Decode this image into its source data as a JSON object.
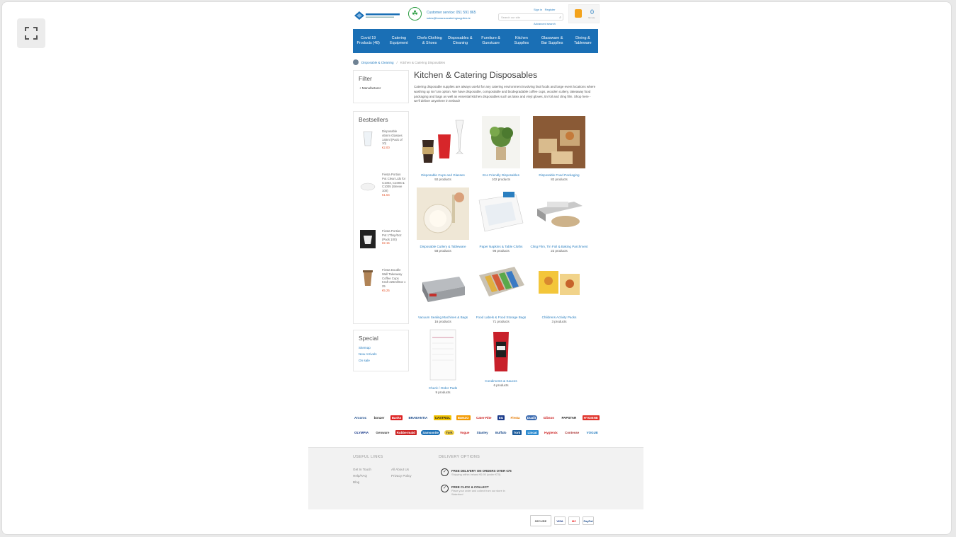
{
  "header": {
    "customer_service": "Customer service: 051 591 865",
    "email": "sales@bonanzacateringsupplies.ie",
    "search_placeholder": "Search our site",
    "sign_in": "Sign in",
    "register": "Register",
    "advanced_search": "Advanced search",
    "cart_count": "0",
    "cart_label": "Item(s)"
  },
  "nav": {
    "items": [
      {
        "label": "Covid 19 Products (48)"
      },
      {
        "label": "Catering Equipment"
      },
      {
        "label": "Chefs Clothing & Shoes"
      },
      {
        "label": "Disposables & Cleaning"
      },
      {
        "label": "Furniture & Guestcare"
      },
      {
        "label": "Kitchen Supplies"
      },
      {
        "label": "Glassware & Bar Supplies"
      },
      {
        "label": "Dining & Tableware"
      }
    ]
  },
  "breadcrumb": {
    "link": "Disposable & Cleaning",
    "sep": "/",
    "current": "Kitchen & Catering Disposables"
  },
  "filter": {
    "title": "Filter",
    "item": "Manufacturer"
  },
  "bestsellers": {
    "title": "Bestsellers",
    "items": [
      {
        "name": "Disposable 46mm Glasses 140ml (Pack of 10)",
        "price": "€2.00"
      },
      {
        "name": "Fiesta Portion Pot Clear Lids for C1003, C1005 & C1005 (Sleeve 100)",
        "price": "€1.64"
      },
      {
        "name": "Fiesta Portion Pot 1Tbsp/3oz (Pack 100)",
        "price": "€2.15"
      },
      {
        "name": "Fiesta Double Wall Takeaway Coffee Cups Kraft 225ml/8oz x 25",
        "price": "€5.25"
      }
    ]
  },
  "special": {
    "title": "Special",
    "links": [
      "Sitemap",
      "New Arrivals",
      "On sale"
    ]
  },
  "main": {
    "title": "Kitchen & Catering Disposables",
    "description": "Catering disposable supplies are always useful for any catering environment involving fast foods and large event locations where washing up isn't an option. We have disposable, compostable and biodegradable coffee cups, wooden cutlery, takeaway food packaging and bags as well as essential kitchen disposables such as latex and vinyl gloves, tin foil and cling film. Shop here - we'll deliver anywhere in Ireland!",
    "categories": [
      {
        "name": "Disposable Cups and Glasses",
        "count": "92 products"
      },
      {
        "name": "Eco Friendly Disposables",
        "count": "102 products"
      },
      {
        "name": "Disposable Food Packaging",
        "count": "82 products"
      },
      {
        "name": "Disposable Cutlery & Tableware",
        "count": "58 products"
      },
      {
        "name": "Paper Napkins & Table Cloths",
        "count": "96 products"
      },
      {
        "name": "Cling Film, Tin Foil & Baking Parchment",
        "count": "22 products"
      },
      {
        "name": "Vacuum Sealing Machines & Bags",
        "count": "16 products"
      },
      {
        "name": "Food Labels & Food Storage Bags",
        "count": "71 products"
      },
      {
        "name": "Childrens Activity Packs",
        "count": "3 products"
      },
      {
        "name": "Check / Order Pads",
        "count": "9 products"
      },
      {
        "name": "Condiments & Sauces",
        "count": "6 products"
      }
    ]
  },
  "brands": {
    "row1": [
      "Arcoroc",
      "bonzer",
      "Banks",
      "BRABANTIA",
      "CASTROL",
      "BUNZO",
      "Cater-Rite",
      "EU",
      "Fiesta",
      "Dualit",
      "Gibson",
      "PAPSTAR",
      "HYGIENE"
    ],
    "row2": [
      "OLYMPIA",
      "Genware",
      "Rubbermaid",
      "Samsonite",
      "Tork",
      "Vogue",
      "Stanley",
      "Buffalo",
      "Tork",
      "Lincat",
      "Hygienix",
      "Contesse",
      "VOGUE"
    ]
  },
  "footer": {
    "useful_links_title": "USEFUL LINKS",
    "col1": [
      "Get In Touch",
      "Help/FAQ",
      "Blog"
    ],
    "col2": [
      "All About Us",
      "Privacy Policy"
    ],
    "delivery_title": "DELIVERY OPTIONS",
    "delivery": [
      {
        "title": "FREE DELIVERY ON ORDERS OVER €75",
        "sub": "Shipping within Ireland €6.95 (under €75)"
      },
      {
        "title": "FREE CLICK & COLLECT",
        "sub": "Place your order and collect from our store in Waterford"
      }
    ]
  },
  "payments": [
    "SECURE",
    "VISA",
    "MC",
    "PayPal"
  ],
  "colors": {
    "nav_bg": "#1a6fb5",
    "link": "#2a7fc0",
    "price": "#e4572e",
    "cart": "#f3a21b"
  }
}
